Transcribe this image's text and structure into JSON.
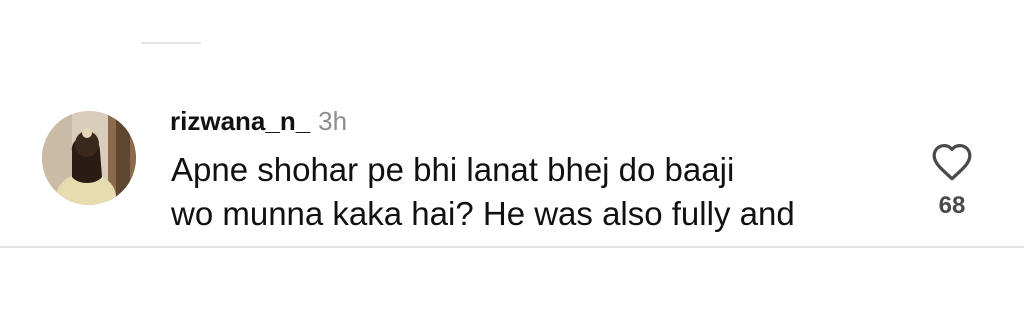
{
  "comment": {
    "username": "rizwana_n_",
    "timestamp": "3h",
    "text_line1": "Apne shohar pe bhi lanat bhej do baaji",
    "text_line2": "wo munna kaka hai? He was also fully and",
    "like_count": "68"
  },
  "icons": {
    "like": "heart-outline-icon",
    "avatar": "profile-photo"
  },
  "colors": {
    "text": "#111111",
    "timestamp": "#8e8e8e",
    "like_count": "#4a4a4a",
    "divider": "#e4e4e4"
  }
}
